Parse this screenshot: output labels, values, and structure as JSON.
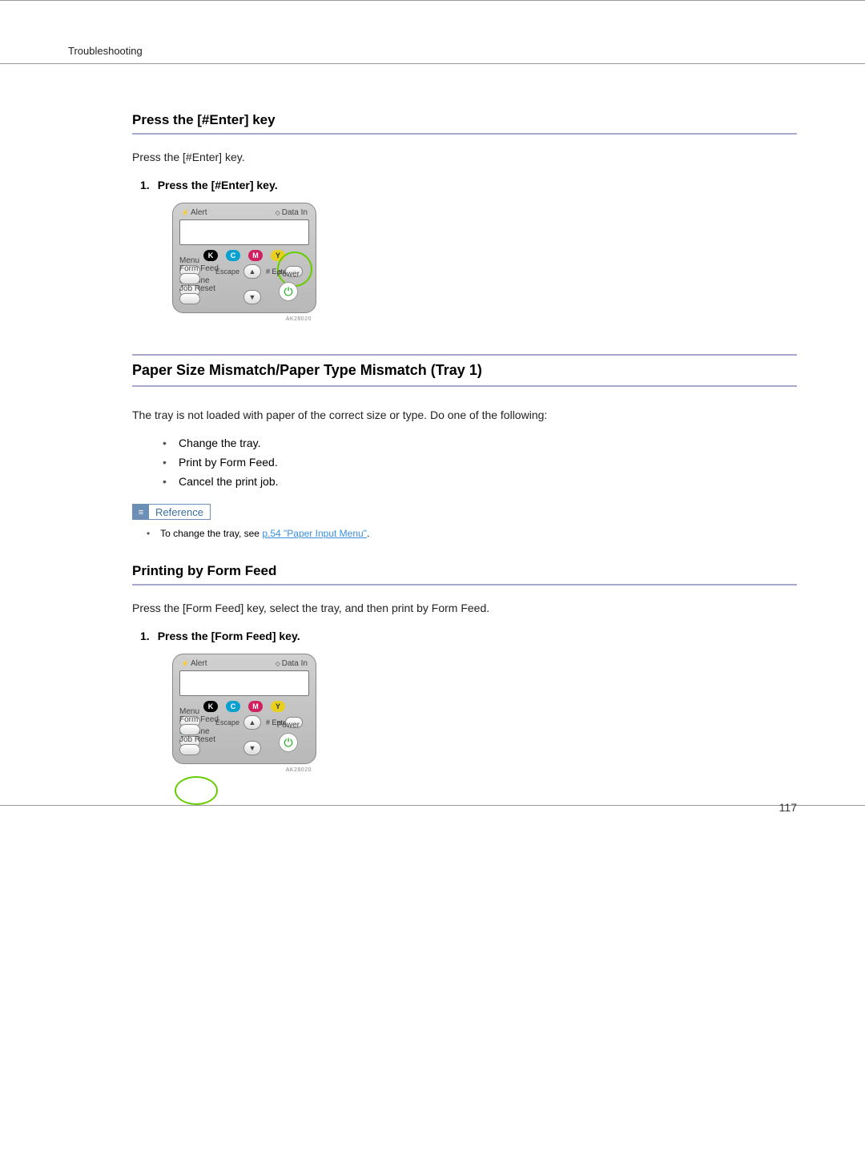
{
  "header": {
    "section": "Troubleshooting"
  },
  "s1": {
    "heading": "Press the [#Enter] key",
    "intro": "Press the [#Enter] key.",
    "step1_num": "1.",
    "step1_text": "Press the [#Enter] key."
  },
  "s2": {
    "heading": "Paper Size Mismatch/Paper Type Mismatch (Tray 1)",
    "intro": "The tray is not loaded with paper of the correct size or type. Do one of the following:",
    "bullets": {
      "b1": "Change the tray.",
      "b2": "Print by Form Feed.",
      "b3": "Cancel the print job."
    },
    "reference_label": "Reference",
    "reference_text_pre": "To change the tray, see ",
    "reference_link": "p.54 \"Paper Input Menu\"",
    "reference_text_post": "."
  },
  "s3": {
    "heading": "Printing by Form Feed",
    "intro": "Press the [Form Feed] key, select the tray, and then print by Form Feed.",
    "step1_num": "1.",
    "step1_text": "Press the [Form Feed] key."
  },
  "panel": {
    "alert": "Alert",
    "data_in": "Data In",
    "k": "K",
    "c": "C",
    "m": "M",
    "y": "Y",
    "menu": "Menu",
    "escape": "Escape",
    "enter": "Enter",
    "online": "Online",
    "form_feed": "Form Feed",
    "job_reset": "Job Reset",
    "power": "Power",
    "power_glyph": "⏻",
    "up": "▲",
    "down": "▼",
    "img_code": "AK28020"
  },
  "page_number": "117"
}
